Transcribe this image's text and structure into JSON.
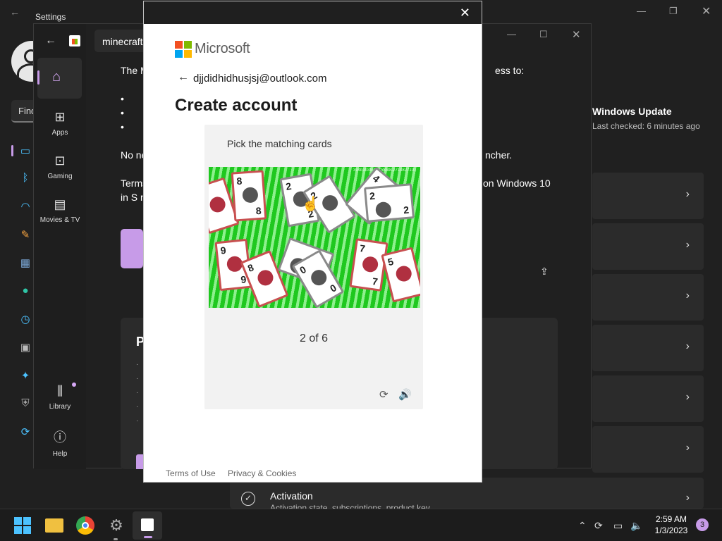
{
  "settings": {
    "title": "Settings",
    "search_placeholder": "Find",
    "windows_update": {
      "title": "Windows Update",
      "subtitle": "Last checked: 6 minutes ago"
    },
    "activation": {
      "title": "Activation",
      "subtitle": "Activation state, subscriptions, product key"
    }
  },
  "store": {
    "search_value": "minecraft",
    "nav": {
      "home": "Home",
      "apps": "Apps",
      "gaming": "Gaming",
      "movies": "Movies & TV",
      "library": "Library",
      "help": "Help"
    },
    "content": {
      "line1": "The M",
      "line1_end": "ess to:",
      "bullet": "•",
      "line2": "No ne",
      "line2_end": "ncher.",
      "line3": "Terms",
      "line3_end": "on Windows 10",
      "line4": "in S m",
      "panel_letter": "P",
      "dot": "·"
    }
  },
  "dialog": {
    "brand": "Microsoft",
    "email": "djjdidhidhusjsj@outlook.com",
    "title": "Create account",
    "captcha": {
      "prompt": "Pick the matching cards",
      "image_code": "394b3b3fc48c2d0d8.2714827101",
      "progress": "2 of 6"
    },
    "footer": {
      "terms": "Terms of Use",
      "privacy": "Privacy & Cookies"
    }
  },
  "taskbar": {
    "time": "2:59 AM",
    "date": "1/3/2023",
    "notification_count": "3"
  }
}
